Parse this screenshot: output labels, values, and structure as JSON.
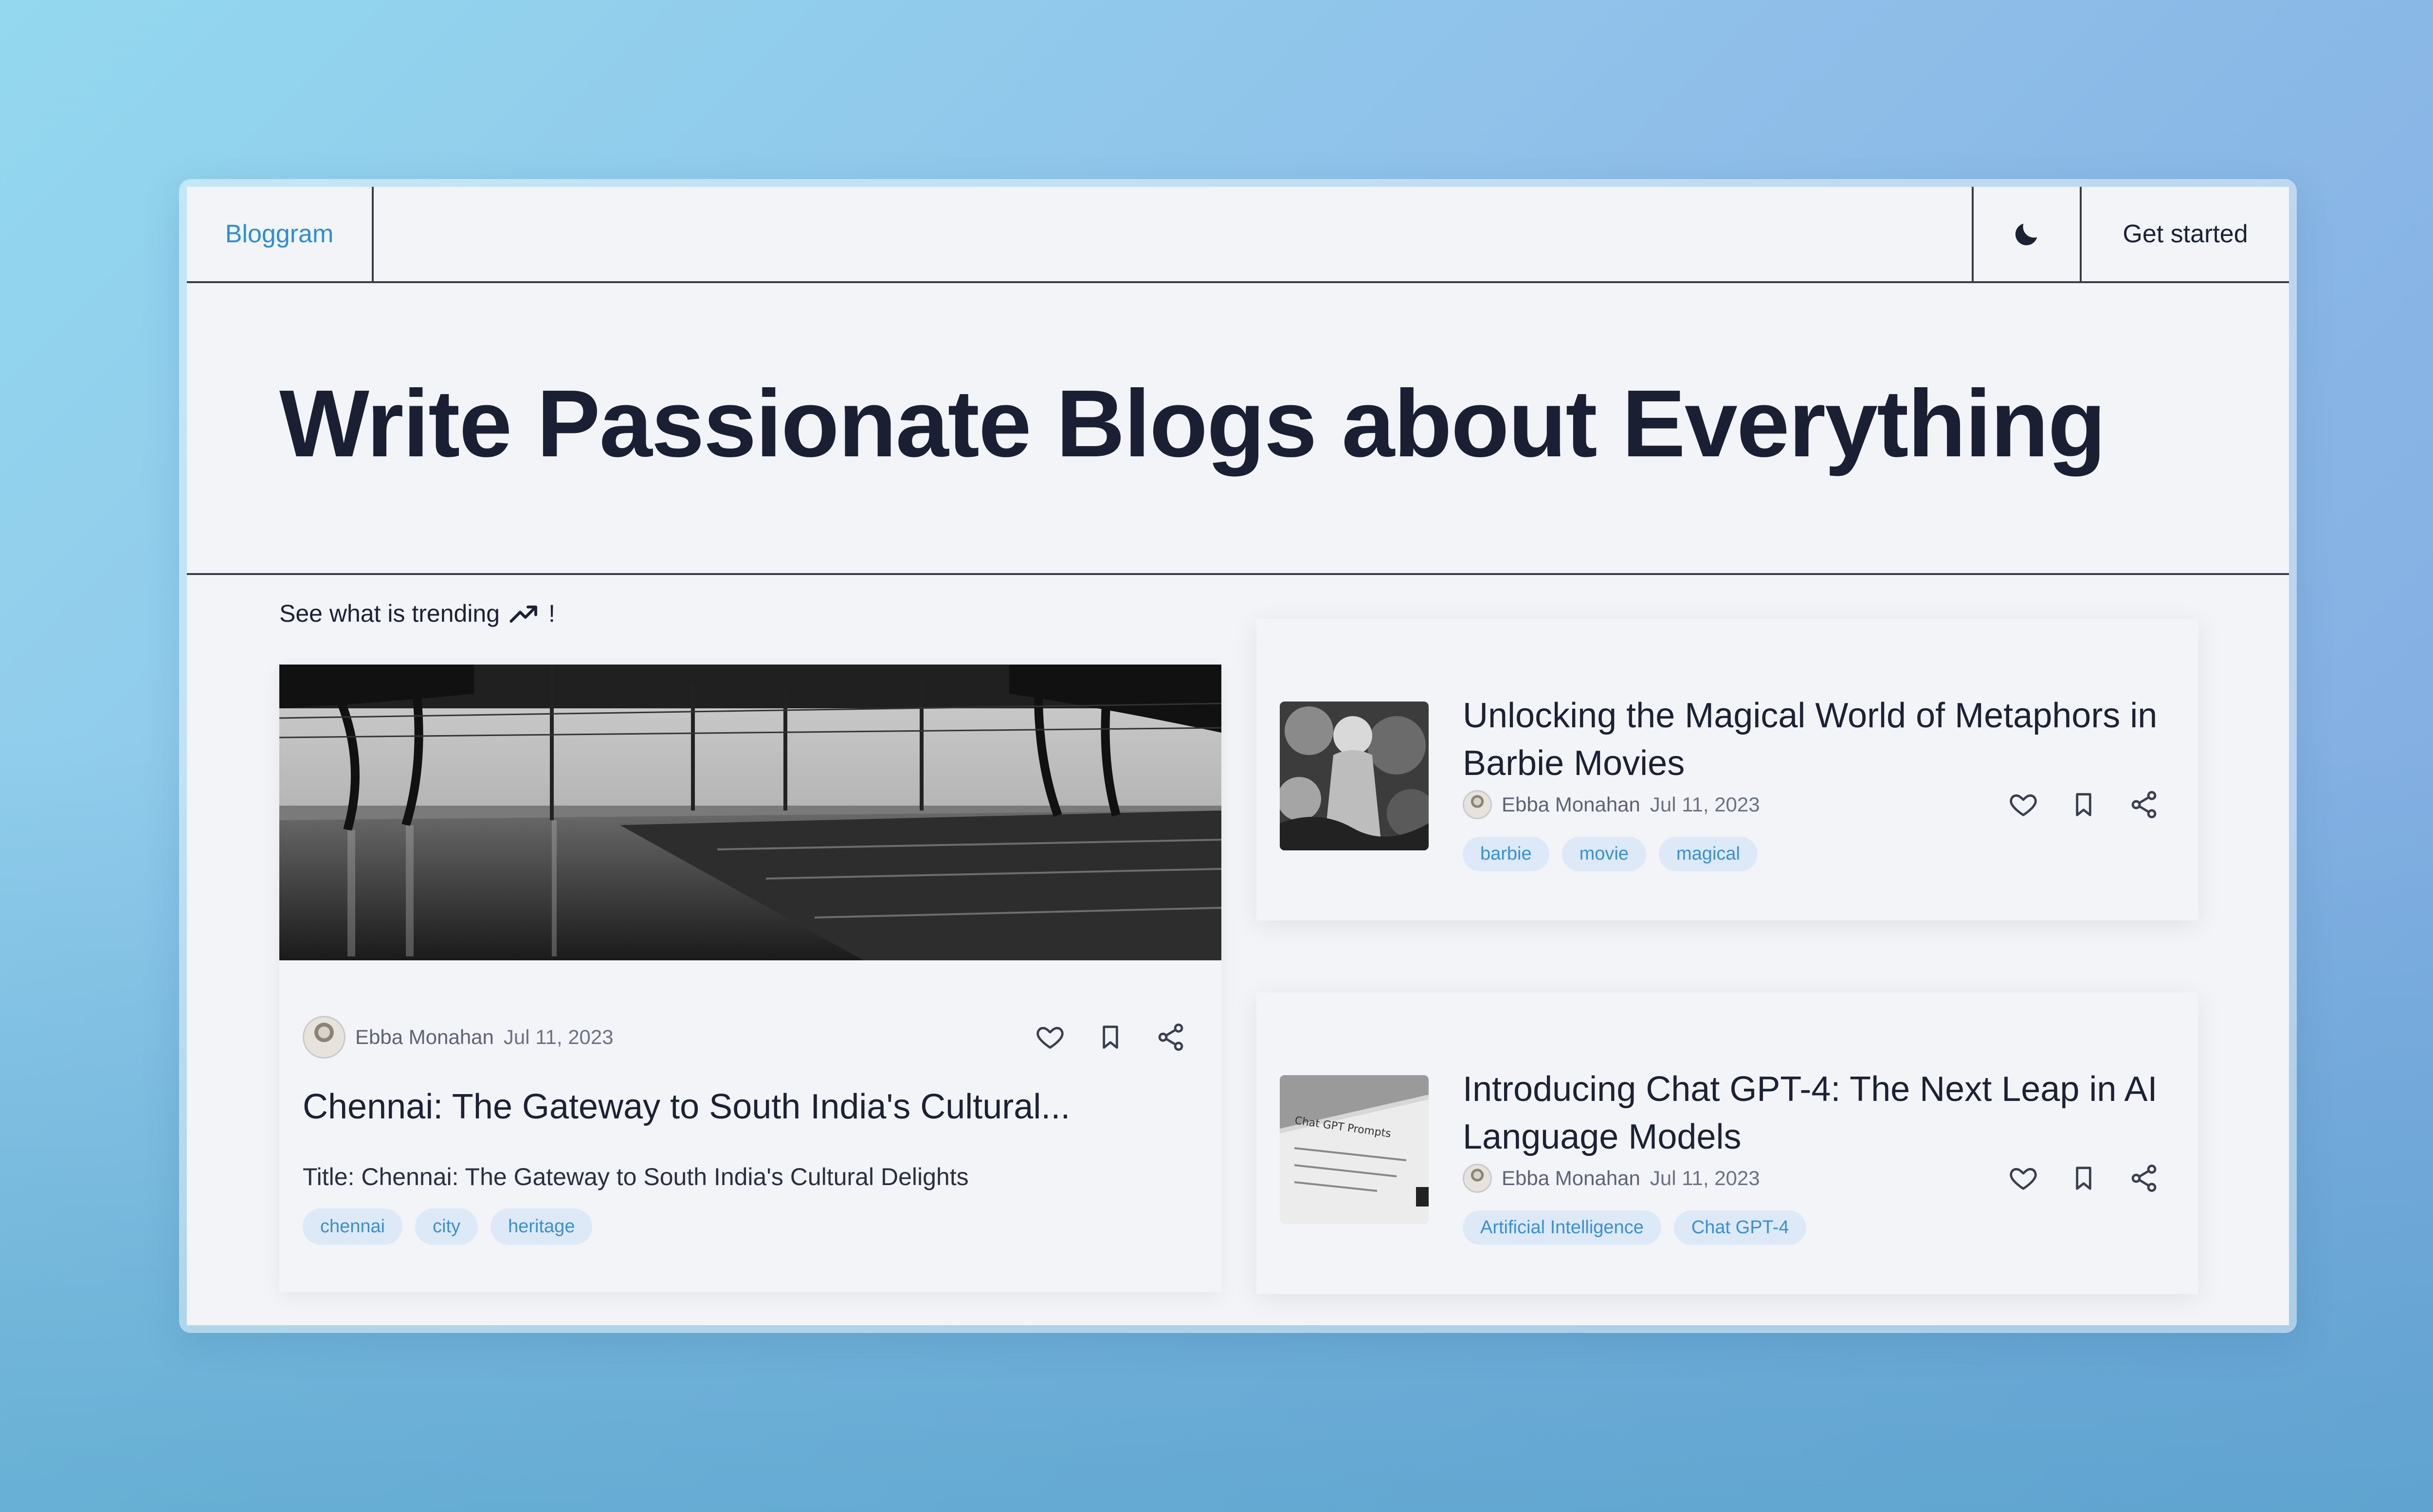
{
  "brand": "Bloggram",
  "nav": {
    "theme_toggle_icon": "moon-icon",
    "cta": "Get started"
  },
  "hero": {
    "title": "Write Passionate Blogs about Everything"
  },
  "trending": {
    "label_before": "See what is trending",
    "icon": "trending-up-icon",
    "label_after": "!"
  },
  "featured": {
    "author": "Ebba Monahan",
    "date": "Jul 11, 2023",
    "title": "Chennai: The Gateway to South India's Cultural...",
    "excerpt": "Title: Chennai: The Gateway to South India's Cultural Delights",
    "tags": [
      "chennai",
      "city",
      "heritage"
    ]
  },
  "posts": [
    {
      "title": "Unlocking the Magical World of Metaphors in Barbie Movies",
      "author": "Ebba Monahan",
      "date": "Jul 11, 2023",
      "tags": [
        "barbie",
        "movie",
        "magical"
      ]
    },
    {
      "title": "Introducing Chat GPT-4: The Next Leap in AI Language Models",
      "author": "Ebba Monahan",
      "date": "Jul 11, 2023",
      "tags": [
        "Artificial Intelligence",
        "Chat GPT-4"
      ],
      "image_text": "Chat GPT Prompts"
    }
  ],
  "colors": {
    "accent": "#2b8fd3",
    "tag_bg": "#dde9f7",
    "page_bg": "#f3f4f8",
    "text": "#1c2133"
  }
}
